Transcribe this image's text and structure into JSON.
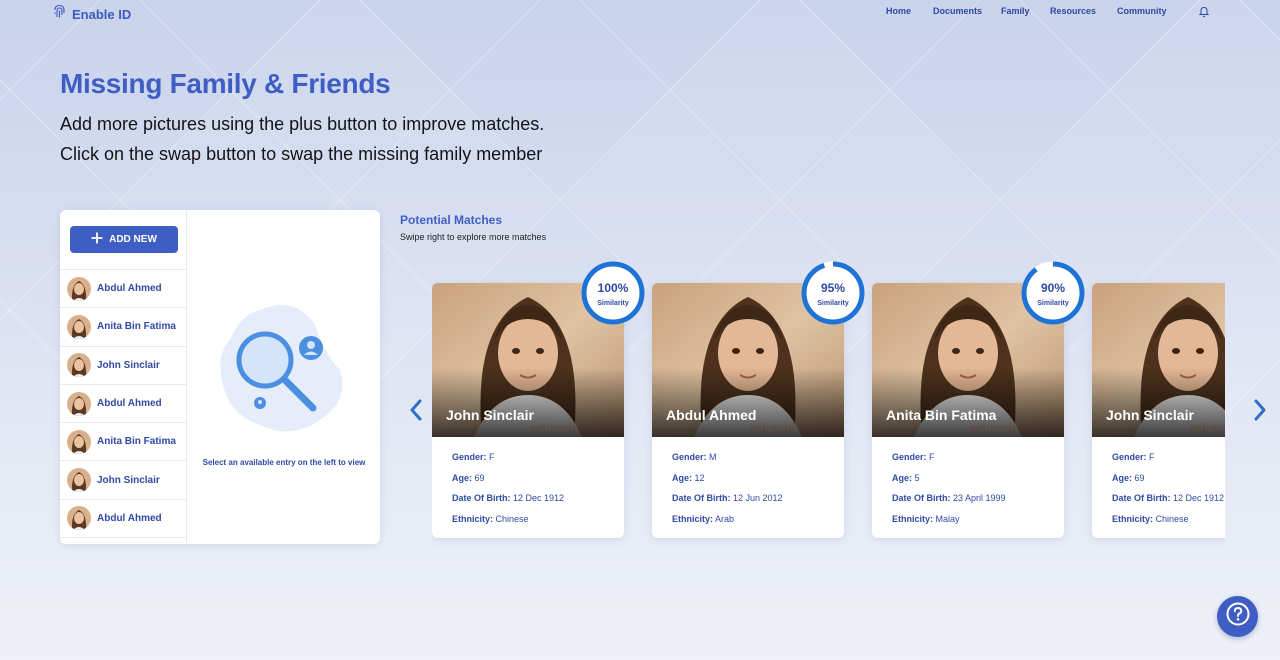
{
  "app": {
    "name": "Enable ID"
  },
  "nav": {
    "items": [
      "Home",
      "Documents",
      "Family",
      "Resources",
      "Community"
    ]
  },
  "header": {
    "title": "Missing Family & Friends",
    "line1": "Add more pictures using the plus button to improve matches.",
    "line2": "Click on the swap button to swap the missing family member"
  },
  "panel": {
    "add_label": "ADD NEW",
    "entries": [
      "Abdul Ahmed",
      "Anita Bin Fatima",
      "John Sinclair",
      "Abdul Ahmed",
      "Anita Bin Fatima",
      "John Sinclair",
      "Abdul Ahmed"
    ],
    "empty_text": "Select an available entry on the left to view"
  },
  "matches": {
    "title": "Potential Matches",
    "subtitle": "Swipe right to explore more matches",
    "similarity_label": "Similarity",
    "watermark": "educati",
    "labels": {
      "gender": "Gender:",
      "age": "Age:",
      "dob": "Date Of Birth:",
      "ethnicity": "Ethnicity:"
    },
    "cards": [
      {
        "name": "John Sinclair",
        "similarity": "100%",
        "similarity_value": 100,
        "gender": "F",
        "age": "69",
        "dob": "12 Dec 1912",
        "ethnicity": "Chinese"
      },
      {
        "name": "Abdul Ahmed",
        "similarity": "95%",
        "similarity_value": 95,
        "gender": "M",
        "age": "12",
        "dob": "12 Jun 2012",
        "ethnicity": "Arab"
      },
      {
        "name": "Anita Bin Fatima",
        "similarity": "90%",
        "similarity_value": 90,
        "gender": "F",
        "age": "5",
        "dob": "23 April 1999",
        "ethnicity": "Malay"
      },
      {
        "name": "John Sinclair",
        "similarity": "",
        "similarity_value": null,
        "gender": "F",
        "age": "69",
        "dob": "12 Dec 1912",
        "ethnicity": "Chinese"
      }
    ]
  },
  "colors": {
    "primary": "#3f5ec4",
    "text_blue": "#2f4aa3",
    "ring": "#1f72d6"
  },
  "icons": {
    "logo": "fingerprint-icon",
    "bell": "bell-icon",
    "add": "plus-icon",
    "prev": "chevron-left-icon",
    "next": "chevron-right-icon",
    "help": "question-icon",
    "empty": "magnifier-user-icon"
  }
}
